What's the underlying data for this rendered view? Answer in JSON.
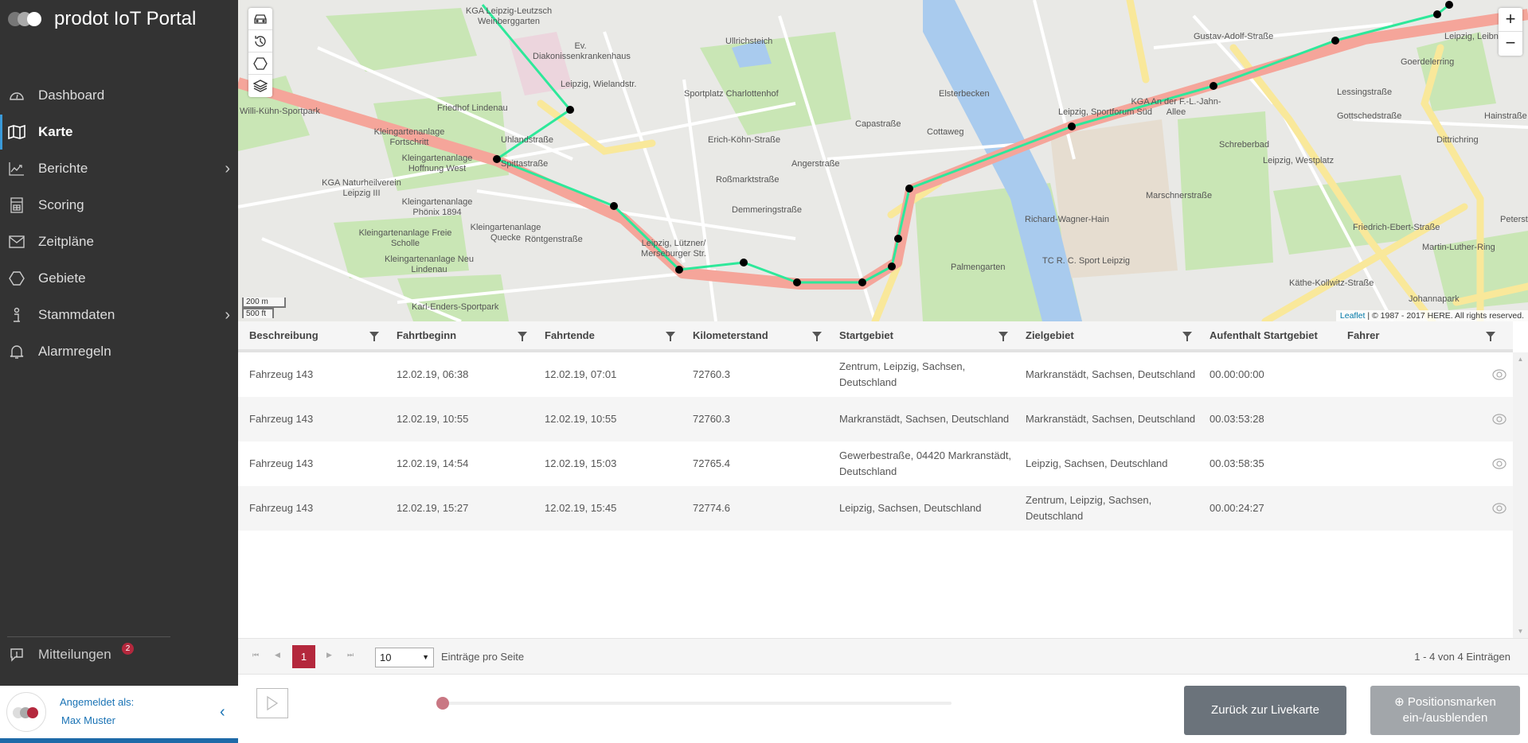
{
  "app": {
    "title": "prodot IoT Portal"
  },
  "sidebar": {
    "items": [
      {
        "label": "Dashboard",
        "icon": "dashboard-gauge-icon"
      },
      {
        "label": "Karte",
        "icon": "map-icon",
        "active": true
      },
      {
        "label": "Berichte",
        "icon": "chart-icon",
        "has_submenu": true
      },
      {
        "label": "Scoring",
        "icon": "calculator-icon"
      },
      {
        "label": "Zeitpläne",
        "icon": "envelope-icon"
      },
      {
        "label": "Gebiete",
        "icon": "hexagon-icon"
      },
      {
        "label": "Stammdaten",
        "icon": "info-icon",
        "has_submenu": true
      },
      {
        "label": "Alarmregeln",
        "icon": "bell-icon"
      }
    ],
    "messages": {
      "label": "Mitteilungen",
      "count": "2"
    },
    "user": {
      "logged_in_label": "Angemeldet als:",
      "name": "Max Muster"
    }
  },
  "map": {
    "controls": [
      "vehicle-icon",
      "history-icon",
      "hexagon-icon",
      "layers-icon"
    ],
    "zoom_in": "+",
    "zoom_out": "−",
    "scale_metric": "200 m",
    "scale_imperial": "500 ft",
    "attribution_link": "Leaflet",
    "attribution_text": " | © 1987 - 2017 HERE. All rights reserved.",
    "labels": [
      "KGA Leipzig-Leutzsch Weinberggarten",
      "Ev. Diakonissenkrankenhaus",
      "Leipzig, Wielandstr.",
      "Friedhof Lindenau",
      "Willi-Kühn-Sportpark",
      "Kleingartenanlage Fortschritt",
      "Kleingartenanlage Hoffnung West",
      "KGA Naturheilverein Leipzig III",
      "Kleingartenanlage Phönix 1894",
      "Kleingartenanlage Freie Scholle",
      "Kleingartenanlage Quecke",
      "Kleingartenanlage Neu Lindenau",
      "Karl-Enders-Sportpark",
      "Leipzig, Lützner/ Merseburger Str.",
      "Sportplatz Charlottenhof",
      "Erich-Köhn-Straße",
      "Roßmarktstraße",
      "Demmeringstraße",
      "Angerstraße",
      "Capastraße",
      "Cottaweg",
      "Elsterbecken",
      "Palmengarten",
      "Richard-Wagner-Hain",
      "Leipzig, Sportforum Süd",
      "KGA An der F.-L.-Jahn-Allee",
      "Marschnerstraße",
      "TC R. C. Sport Leipzig",
      "Schreberbad",
      "Leipzig, Westplatz",
      "Friedrich-Ebert-Straße",
      "Käthe-Kollwitz-Straße",
      "Johannapark",
      "Gustav-Adolf-Straße",
      "Lessingstraße",
      "Gottschedstraße",
      "Leipzig, Leibnizstr.",
      "Goerdelerring",
      "Dittrichring",
      "Martin-Luther-Ring",
      "Hainstraße",
      "Peterstraße",
      "Ullrichsteich",
      "Spittastraße",
      "Uhlandstraße",
      "Röntgenstraße"
    ],
    "colors": {
      "route": "#f5a59a",
      "track": "#2ee89a",
      "stops": "#000000"
    }
  },
  "table": {
    "columns": [
      "Beschreibung",
      "Fahrtbeginn",
      "Fahrtende",
      "Kilometerstand",
      "Startgebiet",
      "Zielgebiet",
      "Aufenthalt Startgebiet",
      "Fahrer"
    ],
    "rows": [
      [
        "Fahrzeug 143",
        "12.02.19, 06:38",
        "12.02.19, 07:01",
        "72760.3",
        "Zentrum, Leipzig, Sachsen, Deutschland",
        "Markranstädt, Sachsen, Deutschland",
        "00.00:00:00",
        ""
      ],
      [
        "Fahrzeug 143",
        "12.02.19, 10:55",
        "12.02.19, 10:55",
        "72760.3",
        "Markranstädt, Sachsen, Deutschland",
        "Markranstädt, Sachsen, Deutschland",
        "00.03:53:28",
        ""
      ],
      [
        "Fahrzeug 143",
        "12.02.19, 14:54",
        "12.02.19, 15:03",
        "72765.4",
        "Gewerbestraße, 04420 Markranstädt, Deutschland",
        "Leipzig, Sachsen, Deutschland",
        "00.03:58:35",
        ""
      ],
      [
        "Fahrzeug 143",
        "12.02.19, 15:27",
        "12.02.19, 15:45",
        "72774.6",
        "Leipzig, Sachsen, Deutschland",
        "Zentrum, Leipzig, Sachsen, Deutschland",
        "00.00:24:27",
        ""
      ]
    ]
  },
  "pager": {
    "current": "1",
    "page_size": "10",
    "per_page_label": "Einträge pro Seite",
    "count_label": "1 - 4 von 4 Einträgen"
  },
  "playback": {
    "progress": 0
  },
  "buttons": {
    "back": "Zurück zur Livekarte",
    "toggle_markers": "Positionsmarken ein-/ausblenden"
  },
  "colors": {
    "sidebar": "#333333",
    "accent": "#b4283d",
    "link": "#1a73b5"
  }
}
